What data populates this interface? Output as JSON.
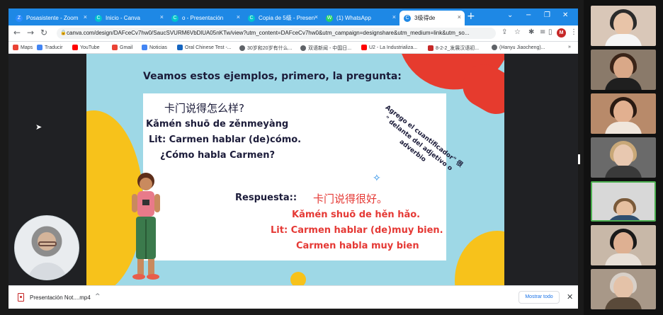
{
  "browser": {
    "tabs": [
      {
        "label": "Posasistente - Zoom",
        "icon": "Z",
        "color": "#ffffff"
      },
      {
        "label": "Inicio - Canva",
        "icon": "C",
        "color": "#00c4cc"
      },
      {
        "label": "o - Presentación",
        "icon": "C",
        "color": "#00c4cc"
      },
      {
        "label": "Copia de 5级 - Presen",
        "icon": "C",
        "color": "#00c4cc"
      },
      {
        "label": "(1) WhatsApp",
        "icon": "W",
        "color": "#25d366"
      },
      {
        "label": "3级得de",
        "icon": "C",
        "color": "#1e88e5"
      }
    ],
    "tab_close": "×",
    "new_tab": "+",
    "window_controls": [
      "⌄",
      "−",
      "❐",
      "✕"
    ],
    "url": "canva.com/design/DAFceCv7hw0/SaucSVURM6VbDlUA05nKTw/view?utm_content=DAFceCv7hw0&utm_campaign=designshare&utm_medium=link&utm_so...",
    "bookmarks": [
      {
        "label": "Maps",
        "color": "#ea4335"
      },
      {
        "label": "Traducir",
        "color": "#4285f4"
      },
      {
        "label": "YouTube",
        "color": "#ff0000"
      },
      {
        "label": "Gmail",
        "color": "#ea4335"
      },
      {
        "label": "Noticias",
        "color": "#4285f4"
      },
      {
        "label": "Oral Chinese Test -...",
        "color": "#1565c0"
      },
      {
        "label": "30岁和20岁有什么...",
        "color": "#5f6368"
      },
      {
        "label": "双语新闻 - 中国日...",
        "color": "#5f6368"
      },
      {
        "label": "U2 - La Industrializa...",
        "color": "#ff0000"
      },
      {
        "label": "8-2-2_发展汉语初...",
        "color": "#c62828"
      },
      {
        "label": "(Hanyu Jiaocheng)...",
        "color": "#5f6368"
      }
    ],
    "bookmarks_overflow": "»",
    "profile_initial": "M"
  },
  "slide": {
    "heading": "Veamos estos ejemplos, primero, la pregunta:",
    "question_chinese": "卡门说得怎么样?",
    "question_pinyin": "Kǎmén shuō de zěnmeyàng",
    "question_literal": "Lit: Carmen hablar (de)cómo.",
    "question_spanish": "¿Cómo habla Carmen?",
    "note": "Agrego el cuantificador\" 很 \" delante del adjetivo o adverbio",
    "answer_label": "Respuesta::",
    "answer_chinese": "卡门说得很好。",
    "answer_pinyin": "Kǎmén shuō de hěn hǎo.",
    "answer_literal": "Lit: Carmen hablar (de)muy bien.",
    "answer_spanish": "Carmen habla muy bien",
    "colors": {
      "background": "#9ed8e6",
      "yellow": "#f7c21b",
      "red": "#e63b2e",
      "text": "#1c1c3a"
    }
  },
  "downloads": {
    "file_name": "Presentación Not....mp4",
    "show_all": "Mostrar todo",
    "close": "✕"
  }
}
